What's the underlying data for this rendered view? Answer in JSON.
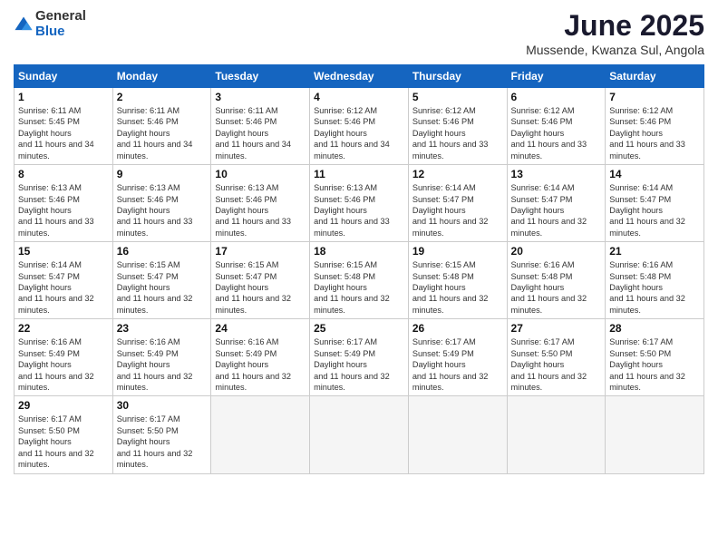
{
  "logo": {
    "general": "General",
    "blue": "Blue"
  },
  "header": {
    "month": "June 2025",
    "location": "Mussende, Kwanza Sul, Angola"
  },
  "days": [
    "Sunday",
    "Monday",
    "Tuesday",
    "Wednesday",
    "Thursday",
    "Friday",
    "Saturday"
  ],
  "weeks": [
    [
      {
        "day": "1",
        "rise": "6:11 AM",
        "set": "5:45 PM",
        "daylight": "11 hours and 34 minutes."
      },
      {
        "day": "2",
        "rise": "6:11 AM",
        "set": "5:46 PM",
        "daylight": "11 hours and 34 minutes."
      },
      {
        "day": "3",
        "rise": "6:11 AM",
        "set": "5:46 PM",
        "daylight": "11 hours and 34 minutes."
      },
      {
        "day": "4",
        "rise": "6:12 AM",
        "set": "5:46 PM",
        "daylight": "11 hours and 34 minutes."
      },
      {
        "day": "5",
        "rise": "6:12 AM",
        "set": "5:46 PM",
        "daylight": "11 hours and 33 minutes."
      },
      {
        "day": "6",
        "rise": "6:12 AM",
        "set": "5:46 PM",
        "daylight": "11 hours and 33 minutes."
      },
      {
        "day": "7",
        "rise": "6:12 AM",
        "set": "5:46 PM",
        "daylight": "11 hours and 33 minutes."
      }
    ],
    [
      {
        "day": "8",
        "rise": "6:13 AM",
        "set": "5:46 PM",
        "daylight": "11 hours and 33 minutes."
      },
      {
        "day": "9",
        "rise": "6:13 AM",
        "set": "5:46 PM",
        "daylight": "11 hours and 33 minutes."
      },
      {
        "day": "10",
        "rise": "6:13 AM",
        "set": "5:46 PM",
        "daylight": "11 hours and 33 minutes."
      },
      {
        "day": "11",
        "rise": "6:13 AM",
        "set": "5:46 PM",
        "daylight": "11 hours and 33 minutes."
      },
      {
        "day": "12",
        "rise": "6:14 AM",
        "set": "5:47 PM",
        "daylight": "11 hours and 32 minutes."
      },
      {
        "day": "13",
        "rise": "6:14 AM",
        "set": "5:47 PM",
        "daylight": "11 hours and 32 minutes."
      },
      {
        "day": "14",
        "rise": "6:14 AM",
        "set": "5:47 PM",
        "daylight": "11 hours and 32 minutes."
      }
    ],
    [
      {
        "day": "15",
        "rise": "6:14 AM",
        "set": "5:47 PM",
        "daylight": "11 hours and 32 minutes."
      },
      {
        "day": "16",
        "rise": "6:15 AM",
        "set": "5:47 PM",
        "daylight": "11 hours and 32 minutes."
      },
      {
        "day": "17",
        "rise": "6:15 AM",
        "set": "5:47 PM",
        "daylight": "11 hours and 32 minutes."
      },
      {
        "day": "18",
        "rise": "6:15 AM",
        "set": "5:48 PM",
        "daylight": "11 hours and 32 minutes."
      },
      {
        "day": "19",
        "rise": "6:15 AM",
        "set": "5:48 PM",
        "daylight": "11 hours and 32 minutes."
      },
      {
        "day": "20",
        "rise": "6:16 AM",
        "set": "5:48 PM",
        "daylight": "11 hours and 32 minutes."
      },
      {
        "day": "21",
        "rise": "6:16 AM",
        "set": "5:48 PM",
        "daylight": "11 hours and 32 minutes."
      }
    ],
    [
      {
        "day": "22",
        "rise": "6:16 AM",
        "set": "5:49 PM",
        "daylight": "11 hours and 32 minutes."
      },
      {
        "day": "23",
        "rise": "6:16 AM",
        "set": "5:49 PM",
        "daylight": "11 hours and 32 minutes."
      },
      {
        "day": "24",
        "rise": "6:16 AM",
        "set": "5:49 PM",
        "daylight": "11 hours and 32 minutes."
      },
      {
        "day": "25",
        "rise": "6:17 AM",
        "set": "5:49 PM",
        "daylight": "11 hours and 32 minutes."
      },
      {
        "day": "26",
        "rise": "6:17 AM",
        "set": "5:49 PM",
        "daylight": "11 hours and 32 minutes."
      },
      {
        "day": "27",
        "rise": "6:17 AM",
        "set": "5:50 PM",
        "daylight": "11 hours and 32 minutes."
      },
      {
        "day": "28",
        "rise": "6:17 AM",
        "set": "5:50 PM",
        "daylight": "11 hours and 32 minutes."
      }
    ],
    [
      {
        "day": "29",
        "rise": "6:17 AM",
        "set": "5:50 PM",
        "daylight": "11 hours and 32 minutes."
      },
      {
        "day": "30",
        "rise": "6:17 AM",
        "set": "5:50 PM",
        "daylight": "11 hours and 32 minutes."
      },
      null,
      null,
      null,
      null,
      null
    ]
  ]
}
